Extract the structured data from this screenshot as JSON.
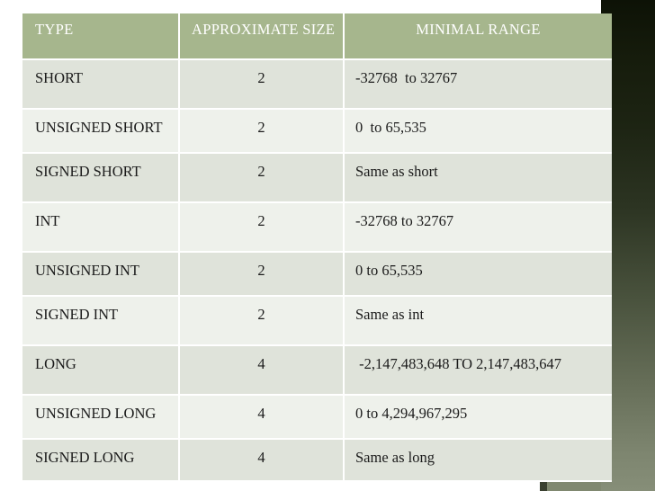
{
  "slide": {
    "background_color": "#ffffff",
    "accent_strip_color": "#1d2413",
    "corner_block_color": "#808870"
  },
  "table": {
    "header_background": "#a6b68d",
    "header_text_color": "#ffffff",
    "row_band_a": "#dfe3da",
    "row_band_b": "#eef1eb",
    "columns": [
      {
        "key": "type",
        "label": "TYPE",
        "align": "left"
      },
      {
        "key": "size",
        "label": "APPROXIMATE SIZE",
        "align": "left"
      },
      {
        "key": "range",
        "label": "MINIMAL RANGE",
        "align": "center"
      }
    ],
    "rows": [
      {
        "type": "SHORT",
        "size": "2",
        "range": "-32768  to 32767"
      },
      {
        "type": "UNSIGNED SHORT",
        "size": "2",
        "range": "0  to 65,535"
      },
      {
        "type": "SIGNED SHORT",
        "size": "2",
        "range": "Same as short"
      },
      {
        "type": "INT",
        "size": "2",
        "range": "-32768 to 32767"
      },
      {
        "type": "UNSIGNED INT",
        "size": "2",
        "range": "0 to 65,535"
      },
      {
        "type": "SIGNED INT",
        "size": "2",
        "range": "Same as int"
      },
      {
        "type": "LONG",
        "size": "4",
        "range": " -2,147,483,648 TO 2,147,483,647"
      },
      {
        "type": "UNSIGNED LONG",
        "size": "4",
        "range": "0 to 4,294,967,295"
      },
      {
        "type": "SIGNED LONG",
        "size": "4",
        "range": "Same as long"
      }
    ]
  }
}
